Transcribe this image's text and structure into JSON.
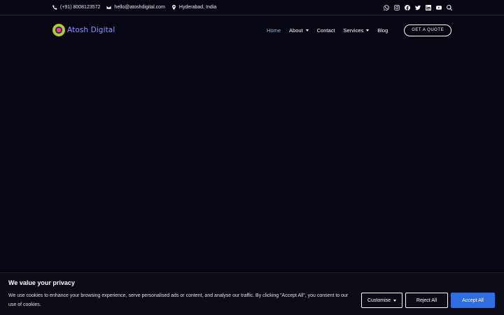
{
  "topbar": {
    "phone": "(+91) 8008123572",
    "email": "hello@atoshdigital.com",
    "location": "Hyderabad, India",
    "socials": [
      "whatsapp-icon",
      "instagram-icon",
      "facebook-icon",
      "twitter-icon",
      "linkedin-icon",
      "youtube-icon",
      "search-icon"
    ]
  },
  "header": {
    "logo_text": "Atosh Digital",
    "nav": [
      {
        "label": "Home",
        "active": true
      },
      {
        "label": "About",
        "dropdown": true
      },
      {
        "label": "Contact"
      },
      {
        "label": "Services",
        "dropdown": true
      },
      {
        "label": "Blog"
      }
    ],
    "cta": "GET A QUOTE"
  },
  "cookie": {
    "title": "We value your privacy",
    "text": "We use cookies to enhance your browsing experience, serve personalised ads or content, and analyse our traffic. By clicking \"Accept All\", you consent to our use of cookies.",
    "customise": "Customise",
    "reject": "Reject All",
    "accept": "Accept All"
  },
  "colors": {
    "background": "#070713",
    "nav_active": "#6ec4e8",
    "logo_text": "#8c96ff",
    "accept_button": "#2f6ee0"
  }
}
